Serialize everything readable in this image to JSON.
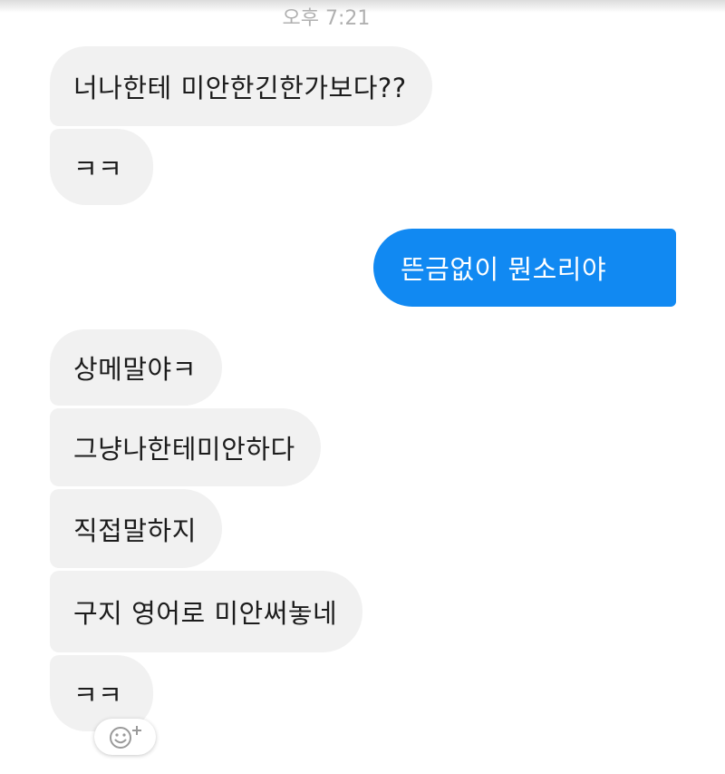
{
  "header": {
    "timestamp": "오후 7:21"
  },
  "messages": [
    {
      "direction": "incoming",
      "text": "너나한테 미안한긴한가보다??"
    },
    {
      "direction": "incoming",
      "text": "ㅋㅋ"
    },
    {
      "direction": "outgoing",
      "text": "뜬금없이 뭔소리야"
    },
    {
      "direction": "incoming",
      "text": "상메말야ㅋ"
    },
    {
      "direction": "incoming",
      "text": "그냥나한테미안하다"
    },
    {
      "direction": "incoming",
      "text": "직접말하지"
    },
    {
      "direction": "incoming",
      "text": "구지 영어로 미안써놓네"
    },
    {
      "direction": "incoming",
      "text": "ㅋㅋ"
    }
  ],
  "reaction_button": {
    "icon": "smiley-plus-icon"
  },
  "colors": {
    "outgoing_bubble": "#1189f2",
    "incoming_bubble": "#f1f1f1",
    "timestamp_text": "#b0b0b0"
  }
}
